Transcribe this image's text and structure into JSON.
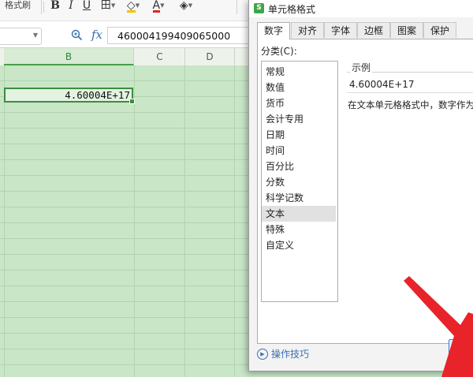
{
  "toolbar": {
    "format_painter_label": "格式刷",
    "bold": "B",
    "italic": "I",
    "underline": "U",
    "border_icon": "田",
    "fill_icon": "◇",
    "font_color_icon": "A",
    "clear_icon": "◈"
  },
  "formula_bar": {
    "fx": "fx",
    "value": "460004199409065000"
  },
  "columns": [
    "B",
    "C",
    "D"
  ],
  "cell": {
    "display_value": "4.60004E+17"
  },
  "dialog": {
    "title": "单元格格式",
    "icon_letter": "S",
    "tabs": [
      "数字",
      "对齐",
      "字体",
      "边框",
      "图案",
      "保护"
    ],
    "active_tab": "数字",
    "category_label": "分类(C):",
    "categories": [
      "常规",
      "数值",
      "货币",
      "会计专用",
      "日期",
      "时间",
      "百分比",
      "分数",
      "科学记数",
      "文本",
      "特殊",
      "自定义"
    ],
    "selected_category": "文本",
    "sample_title": "示例",
    "sample_value": "4.60004E+17",
    "description": "在文本单元格格式中，数字作为文",
    "help_label": "操作技巧",
    "ok_label": "确"
  },
  "colors": {
    "grid_fill": "#c9e6c7",
    "selection_border": "#3c8d3e",
    "annotation_arrow": "#e8232a",
    "ok_border": "#3c7fd4"
  }
}
